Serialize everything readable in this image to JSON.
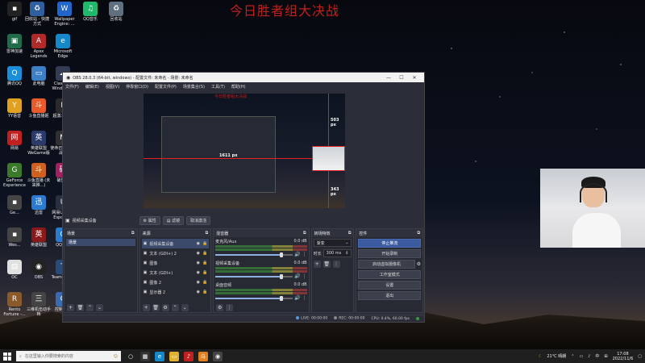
{
  "overlay": {
    "title": "今日胜者组大决战"
  },
  "desktop": {
    "icons": [
      {
        "label": "gif",
        "color": "#222222",
        "glyph": "▪"
      },
      {
        "label": "回收站 - 快捷方式",
        "color": "#2f5f9f",
        "glyph": "♻"
      },
      {
        "label": "Wallpaper Engine: ...",
        "color": "#2266cc",
        "glyph": "W"
      },
      {
        "label": "QQ音乐",
        "color": "#20b86a",
        "glyph": "♫"
      },
      {
        "label": "回收站",
        "color": "#607080",
        "glyph": "♻"
      },
      {
        "label": "雷神加速",
        "color": "#1f6b4a",
        "glyph": "▣"
      },
      {
        "label": "Apex Legends",
        "color": "#b02a2a",
        "glyph": "A"
      },
      {
        "label": "Microsoft Edge",
        "color": "#1488c8",
        "glyph": "e"
      },
      {
        "label": "腾讯QQ",
        "color": "#1a8fd8",
        "glyph": "Q"
      },
      {
        "label": "此电脑",
        "color": "#3c7fc4",
        "glyph": "▭"
      },
      {
        "label": "Clash for Windows...",
        "color": "#333c55",
        "glyph": "☁"
      },
      {
        "label": "YY语音",
        "color": "#e0a020",
        "glyph": "Y"
      },
      {
        "label": "斗鱼直播姬",
        "color": "#e85a2a",
        "glyph": "斗"
      },
      {
        "label": "超激斗梦境",
        "color": "#2a2a2a",
        "glyph": "F"
      },
      {
        "label": "网易",
        "color": "#c02020",
        "glyph": "网"
      },
      {
        "label": "英雄联盟 WeGame版",
        "color": "#2a3a6a",
        "glyph": "英"
      },
      {
        "label": "使命召唤 现代战争",
        "color": "#303030",
        "glyph": "M"
      },
      {
        "label": "GeForce Experience",
        "color": "#3a7a2a",
        "glyph": "G"
      },
      {
        "label": "斗鱼直播 (未来推...)",
        "color": "#d06020",
        "glyph": "斗"
      },
      {
        "label": "破壁人",
        "color": "#a02060",
        "glyph": "破"
      },
      {
        "label": "Ge...",
        "color": "#444444",
        "glyph": "▪"
      },
      {
        "label": "迅雷",
        "color": "#2a7ad0",
        "glyph": "迅"
      },
      {
        "label": "网易UU加速 Esports...",
        "color": "#2a3040",
        "glyph": "U"
      },
      {
        "label": "Wes...",
        "color": "#444444",
        "glyph": "▪"
      },
      {
        "label": "英雄联盟",
        "color": "#8a1a1a",
        "glyph": "英"
      },
      {
        "label": "QQ游戏",
        "color": "#2a7ad0",
        "glyph": "Q"
      },
      {
        "label": "OC",
        "color": "#e0e0e0",
        "glyph": "▤"
      },
      {
        "label": "OBS",
        "color": "#222222",
        "glyph": "◉"
      },
      {
        "label": "TeamSpeak 3",
        "color": "#2a4a7a",
        "glyph": "T"
      },
      {
        "label": "Rento Fortune -...",
        "color": "#8a5a2a",
        "glyph": "R"
      },
      {
        "label": "三维机伍动手档",
        "color": "#444444",
        "glyph": "三"
      },
      {
        "label": "控制面板",
        "color": "#3a6ab0",
        "glyph": "⚙"
      }
    ]
  },
  "obs": {
    "title": "OBS 28.0.3 (64-bit, windows) - 配置文件: 未命名 - 场景: 未命名",
    "menu": [
      "文件(F)",
      "编辑(E)",
      "视图(V)",
      "停靠窗口(D)",
      "配置文件(P)",
      "场景集合(S)",
      "工具(T)",
      "帮助(H)"
    ],
    "preview": {
      "inner_title": "今日胜者组大决战",
      "px_top": "503 px",
      "px_left": "1611 px",
      "px_bottom": "343 px"
    },
    "source_toolbar": {
      "name": "视频采集设备",
      "properties": "属性",
      "filters": "滤镜",
      "deactivate": "取消激活"
    },
    "docks": {
      "scenes": {
        "title": "场景",
        "items": [
          "场景"
        ]
      },
      "sources": {
        "title": "来源",
        "items": [
          {
            "name": "视频采集设备",
            "selected": true
          },
          {
            "name": "文本 (GDI+) 2",
            "selected": false
          },
          {
            "name": "图像",
            "selected": false
          },
          {
            "name": "文本 (GDI+)",
            "selected": false
          },
          {
            "name": "图像 2",
            "selected": false
          },
          {
            "name": "显示器 2",
            "selected": false
          }
        ]
      },
      "mixer": {
        "title": "混音器",
        "channels": [
          {
            "name": "麦克风/Aux",
            "db": "0.0 dB",
            "level": 0.85
          },
          {
            "name": "视频采集设备",
            "db": "0.0 dB",
            "level": 0.85
          },
          {
            "name": "桌面音频",
            "db": "0.0 dB",
            "level": 0.85
          }
        ]
      },
      "transitions": {
        "title": "转场特效",
        "type": "渐变",
        "duration_label": "时长",
        "duration_value": "300 ms"
      },
      "controls": {
        "title": "控件",
        "buttons": [
          "停止推流",
          "开始录制",
          "启动虚拟摄像机",
          "工作室模式",
          "设置",
          "退出"
        ]
      }
    },
    "status": {
      "live": "LIVE: 00:00:00",
      "rec": "REC: 00:00:00",
      "cpu": "CPU: 0.4%, 60.00 fps"
    }
  },
  "taskbar": {
    "search_placeholder": "在这里输入你要搜索的内容",
    "weather": "21°C  晴朗",
    "ime": "中",
    "time": "17:08",
    "date": "2022/11/6"
  },
  "colors": {
    "accent": "#3b5aa0",
    "overlay_red": "#c0201c",
    "selection": "#e02020"
  }
}
